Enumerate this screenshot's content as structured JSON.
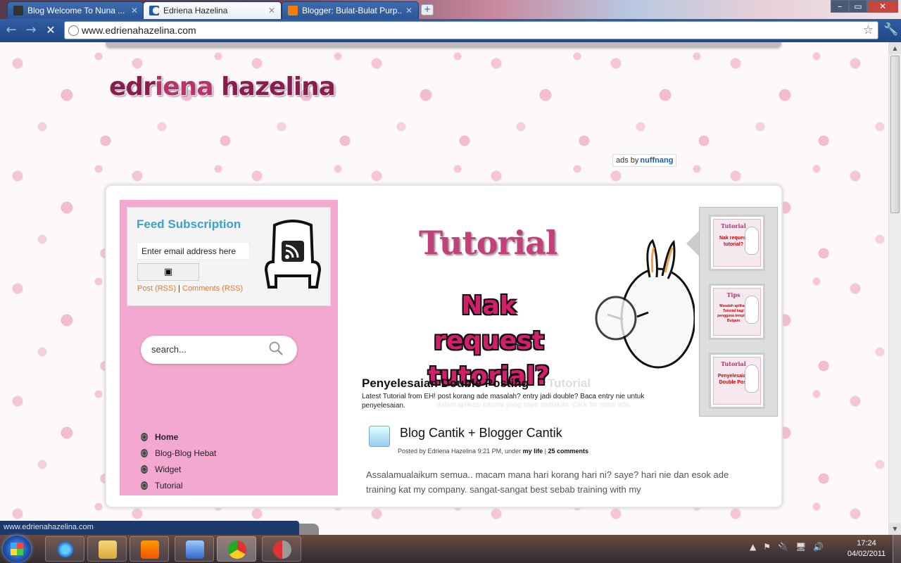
{
  "browser": {
    "tabs": [
      {
        "label": "Blog Welcome To Nuna ...",
        "active": false,
        "favicon_color": "#333333"
      },
      {
        "label": "Edriena Hazelina",
        "active": true,
        "favicon_color": "#1f5ba6"
      },
      {
        "label": "Blogger: Bulat-Bulat Purp...",
        "active": false,
        "favicon_color": "#f57d00"
      }
    ],
    "new_tab_label": "+",
    "window_controls": {
      "minimize": "–",
      "maximize": "▭",
      "close": "✕"
    },
    "url": "www.edrienahazelina.com",
    "status_url": "www.edrienahazelina.com"
  },
  "site": {
    "logo": {
      "part1": "edr",
      "part2": "iena ",
      "part3": "hazelina"
    },
    "ads_label": "ads by",
    "ads_brand": "nuffnang",
    "feed": {
      "title": "Feed Subscription",
      "email_placeholder": "Enter email address here",
      "post_rss": "Post (RSS)",
      "separator": " | ",
      "comments_rss": "Comments (RSS)"
    },
    "search_placeholder": "search...",
    "nav": [
      "Home",
      "Blog-Blog Hebat",
      "Widget",
      "Tutorial"
    ],
    "featured": {
      "tutorial_text": "Tutorial",
      "request_line1": "Nak request",
      "request_line2": "tutorial?",
      "heading": "Penyelesaian Double Posting",
      "ghost_heading": "Tutorial",
      "description": "Latest Tutorial from EH! post korang ade masalah? entry jadi double? Baca entry nie untuk penyelesaian.",
      "ghost_description": "dalam aplikasi tutorial yang saye sediakan. Click for more info.",
      "thumbnails": [
        {
          "title": "Tutorial",
          "subtitle": "Nak request tutorial?"
        },
        {
          "title": "Tips",
          "subtitle": "Masalah aplikasi Tutorial bagi pengguna template Bulgam"
        },
        {
          "title": "Tutorial",
          "subtitle": "Penyelesaian Double Post"
        }
      ]
    },
    "post": {
      "title": "Blog Cantik + Blogger Cantik",
      "meta_prefix": "Posted by Edriena Hazelina 9:21 PM, under ",
      "category": "my life",
      "meta_sep": " | ",
      "comments": "25 comments",
      "body": "Assalamualaikum semua.. macam mana hari korang hari ni? saye? hari nie dan esok ade training kat my company. sangat-sangat best sebab training with my"
    }
  },
  "taskbar": {
    "time": "17:24",
    "date": "04/02/2011",
    "apps": [
      "windows-explorer",
      "internet-explorer",
      "file-explorer",
      "media-player",
      "download-manager",
      "chrome",
      "recorder"
    ]
  },
  "colors": {
    "accent_pink": "#f3a8d2",
    "logo_pink": "#b8336a",
    "feed_blue": "#3aa3c6",
    "chrome_blue": "#2f5ea3"
  }
}
